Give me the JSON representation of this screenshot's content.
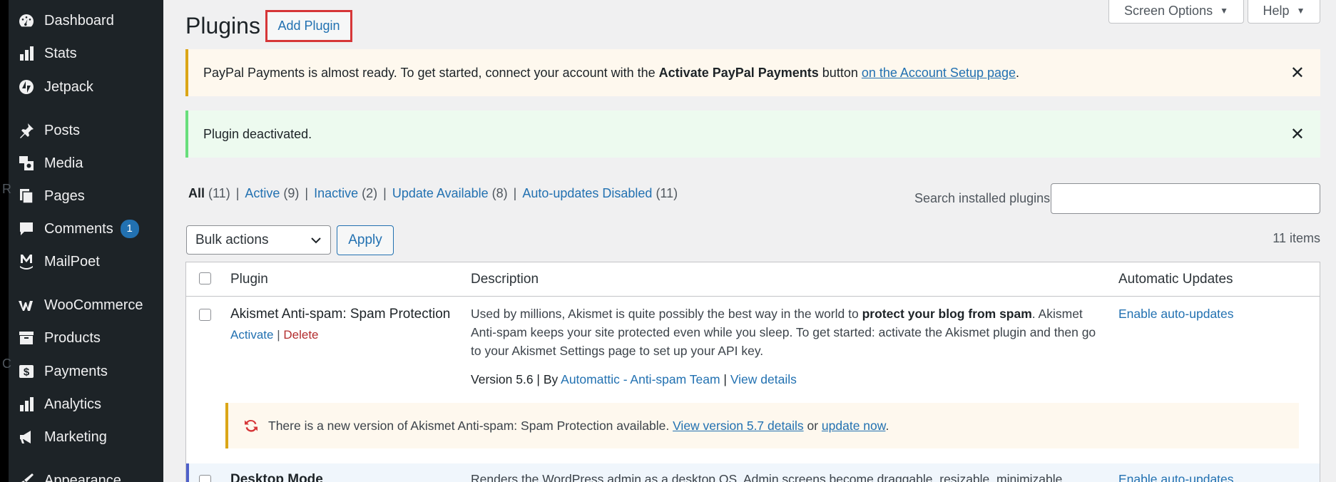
{
  "sidebar": {
    "items": [
      {
        "label": "Dashboard",
        "icon": "dashboard-icon"
      },
      {
        "label": "Stats",
        "icon": "stats-icon"
      },
      {
        "label": "Jetpack",
        "icon": "jetpack-icon"
      },
      {
        "label": "Posts",
        "icon": "pin-icon"
      },
      {
        "label": "Media",
        "icon": "media-icon"
      },
      {
        "label": "Pages",
        "icon": "pages-icon"
      },
      {
        "label": "Comments",
        "icon": "comment-icon",
        "badge": "1"
      },
      {
        "label": "MailPoet",
        "icon": "mailpoet-icon"
      },
      {
        "label": "WooCommerce",
        "icon": "woocommerce-icon"
      },
      {
        "label": "Products",
        "icon": "archive-icon"
      },
      {
        "label": "Payments",
        "icon": "dollar-icon"
      },
      {
        "label": "Analytics",
        "icon": "bar-chart-icon"
      },
      {
        "label": "Marketing",
        "icon": "megaphone-icon"
      },
      {
        "label": "Appearance",
        "icon": "brush-icon"
      }
    ],
    "stray_letters": [
      "R",
      "C"
    ]
  },
  "header": {
    "title": "Plugins",
    "add_plugin": "Add Plugin",
    "screen_options": "Screen Options",
    "help": "Help"
  },
  "notices": {
    "paypal": {
      "pre": "PayPal Payments is almost ready. To get started, connect your account with the ",
      "bold": "Activate PayPal Payments",
      "mid": " button ",
      "link": "on the Account Setup page",
      "end": "."
    },
    "deactivated": "Plugin deactivated."
  },
  "filters": {
    "all_label": "All",
    "all_count": "(11)",
    "active_label": "Active",
    "active_count": "(9)",
    "inactive_label": "Inactive",
    "inactive_count": "(2)",
    "update_label": "Update Available",
    "update_count": "(8)",
    "autoupd_label": "Auto-updates Disabled",
    "autoupd_count": "(11)",
    "sep": "|"
  },
  "search": {
    "label": "Search installed plugins",
    "value": ""
  },
  "bulk": {
    "selected": "Bulk actions",
    "apply": "Apply",
    "items_count": "11 items"
  },
  "table": {
    "headers": {
      "plugin": "Plugin",
      "description": "Description",
      "auto": "Automatic Updates"
    },
    "rows": [
      {
        "name": "Akismet Anti-spam: Spam Protection",
        "activate": "Activate",
        "sep": "|",
        "delete": "Delete",
        "desc_pre": "Used by millions, Akismet is quite possibly the best way in the world to ",
        "desc_bold": "protect your blog from spam",
        "desc_post": ". Akismet Anti-spam keeps your site protected even while you sleep. To get started: activate the Akismet plugin and then go to your Akismet Settings page to set up your API key.",
        "version": "Version 5.6 | By ",
        "author": "Automattic - Anti-spam Team",
        "meta_sep": " | ",
        "view_details": "View details",
        "auto_link": "Enable auto-updates",
        "update_notice": {
          "pre": "There is a new version of Akismet Anti-spam: Spam Protection available. ",
          "link1": "View version 5.7 details",
          "mid": " or ",
          "link2": "update now",
          "end": "."
        }
      },
      {
        "name": "Desktop Mode",
        "desc": "Renders the WordPress admin as a desktop OS. Admin screens become draggable, resizable, minimizable",
        "auto_link": "Enable auto-updates"
      }
    ]
  },
  "colors": {
    "sidebar_bg": "#1d2327",
    "link": "#2271b1",
    "highlight_border": "#d63638"
  }
}
